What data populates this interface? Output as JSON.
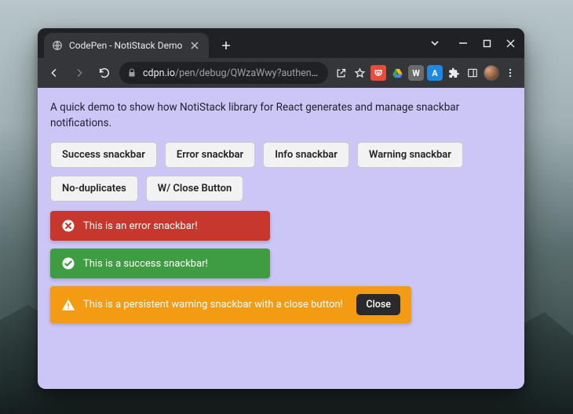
{
  "tab": {
    "title": "CodePen - NotiStack Demo"
  },
  "url": {
    "domain": "cdpn.io",
    "path": "/pen/debug/QWzaWwy?authentic..."
  },
  "page": {
    "description": "A quick demo to show how NotiStack library for React generates and manage snackbar notifications.",
    "buttons": [
      "Success snackbar",
      "Error snackbar",
      "Info snackbar",
      "Warning snackbar",
      "No-duplicates",
      "W/ Close Button"
    ],
    "snackbars": {
      "error": {
        "message": "This is an error snackbar!"
      },
      "success": {
        "message": "This is a success snackbar!"
      },
      "warning": {
        "message": "This is a persistent warning snackbar with a close button!",
        "close_label": "Close"
      }
    }
  },
  "ext_icons": [
    "share",
    "star",
    "pocket",
    "gdrive",
    "W-wiki",
    "A-app",
    "puzzle",
    "panel"
  ],
  "colors": {
    "page_bg": "#cbc6f6",
    "error": "#c8372d",
    "success": "#3e9c42",
    "warning": "#f39b12"
  }
}
